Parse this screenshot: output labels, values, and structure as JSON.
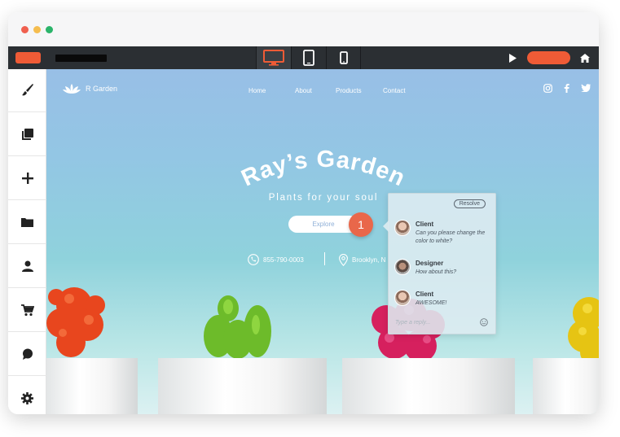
{
  "toolbar": {
    "devices": [
      "desktop",
      "tablet",
      "mobile"
    ],
    "active_device": "desktop",
    "accent_color": "#ef5b36"
  },
  "sidebar": {
    "items": [
      {
        "icon": "paintbrush-icon"
      },
      {
        "icon": "layers-icon"
      },
      {
        "icon": "plus-icon"
      },
      {
        "icon": "folder-icon"
      },
      {
        "icon": "user-icon"
      },
      {
        "icon": "cart-icon"
      },
      {
        "icon": "chat-icon"
      },
      {
        "icon": "gear-icon"
      }
    ]
  },
  "site": {
    "logo_text": "R Garden",
    "nav": [
      "Home",
      "About",
      "Products",
      "Contact"
    ],
    "social": [
      "instagram-icon",
      "facebook-icon",
      "twitter-icon"
    ],
    "hero_title": "Ray’s Garden",
    "hero_subtitle": "Plants for your soul",
    "explore_label": "Explore",
    "phone": "855-790-0003",
    "location": "Brooklyn, N"
  },
  "comments": {
    "marker_number": "1",
    "resolve_label": "Resolve",
    "items": [
      {
        "author": "Client",
        "text": "Can you please change the color to white?"
      },
      {
        "author": "Designer",
        "text": "How about this?"
      },
      {
        "author": "Client",
        "text": "AWESOME!"
      }
    ],
    "reply_placeholder": "Type a reply..."
  }
}
